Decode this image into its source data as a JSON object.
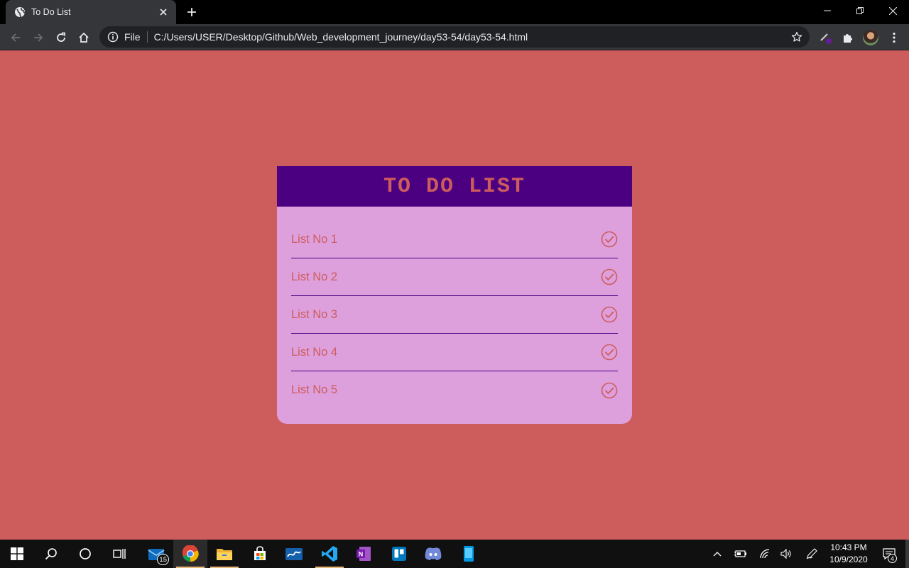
{
  "browser": {
    "tab_title": "To Do List",
    "omnibox_scheme": "File",
    "url": "C:/Users/USER/Desktop/Github/Web_development_journey/day53-54/day53-54.html"
  },
  "page": {
    "title": "TO DO LIST",
    "items": [
      {
        "label": "List No 1"
      },
      {
        "label": "List No 2"
      },
      {
        "label": "List No 3"
      },
      {
        "label": "List No 4"
      },
      {
        "label": "List No 5"
      }
    ],
    "colors": {
      "background": "#cd5c5c",
      "header": "#4b0082",
      "card": "#dda0dd",
      "accent": "#cd5c5c"
    }
  },
  "taskbar": {
    "mail_badge": "15",
    "time": "10:43 PM",
    "date": "10/9/2020",
    "notification_count": "4",
    "apps": [
      "start",
      "search",
      "cortana",
      "task-view",
      "mail",
      "chrome",
      "file-explorer",
      "store",
      "whiteboard",
      "vscode",
      "onenote",
      "trello",
      "discord",
      "phone"
    ]
  }
}
